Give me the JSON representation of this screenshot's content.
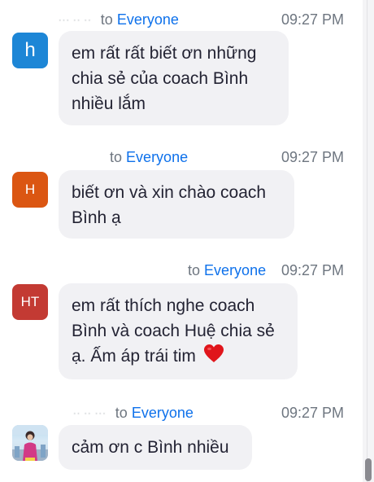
{
  "messages": [
    {
      "sender_name": "··· ·· ··",
      "to_prefix": "to",
      "recipient": "Everyone",
      "time": "09:27 PM",
      "avatar_text": "h",
      "text": "em rất rất biết ơn những chia sẻ  của coach Bình nhiều lắm"
    },
    {
      "sender_name": "",
      "to_prefix": "to",
      "recipient": "Everyone",
      "time": "09:27 PM",
      "avatar_text": "H",
      "text": "biết ơn và xin chào coach Bình ạ"
    },
    {
      "sender_name": "",
      "to_prefix": "to",
      "recipient": "Everyone",
      "time": "09:27 PM",
      "avatar_text": "HT",
      "text": "em rất thích nghe coach Bình và coach Huệ chia sẻ ạ. Ấm áp trái tim",
      "emoji": "heart-emoji"
    },
    {
      "sender_name": "·· ·· ···",
      "to_prefix": "to",
      "recipient": "Everyone",
      "time": "09:27 PM",
      "avatar_text": "",
      "avatar_type": "photo",
      "text": "cảm ơn c Bình nhiều"
    }
  ],
  "colors": {
    "recipient_link": "#0e71eb",
    "bubble_bg": "#f1f1f4",
    "avatar_h": "#1d86d6",
    "avatar_H": "#db5612",
    "avatar_HT": "#c33a33",
    "heart": "#e0151b"
  }
}
